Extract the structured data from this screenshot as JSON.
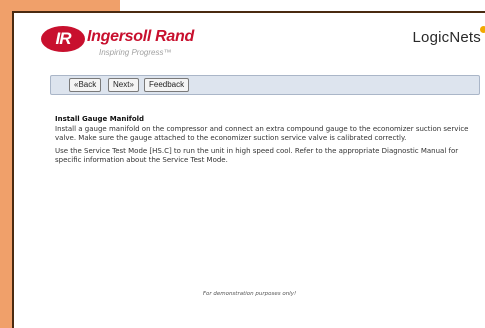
{
  "header": {
    "logo": {
      "mark": "IR",
      "name": "Ingersoll Rand",
      "tagline": "Inspiring Progress™"
    },
    "brand": "LogicNets"
  },
  "toolbar": {
    "back_label": "«Back",
    "next_label": "Next»",
    "feedback_label": "Feedback"
  },
  "content": {
    "title": "Install Gauge Manifold",
    "paragraphs": [
      "Install a gauge manifold on the compressor and connect an extra compound gauge to the economizer suction service valve. Make sure the gauge attached to the economizer suction service valve is calibrated correctly.",
      "Use the Service Test Mode [HS.C] to run the unit in high speed cool. Refer to the appropriate Diagnostic Manual for specific information about the Service Test Mode."
    ]
  },
  "footer": {
    "disclaimer": "For demonstration purposes only!"
  },
  "colors": {
    "background": "#f0a06a",
    "brand_red": "#c8102e",
    "toolbar": "#dde4ee",
    "frame_border": "#4a2a10",
    "brand_dot": "#f2a900"
  }
}
